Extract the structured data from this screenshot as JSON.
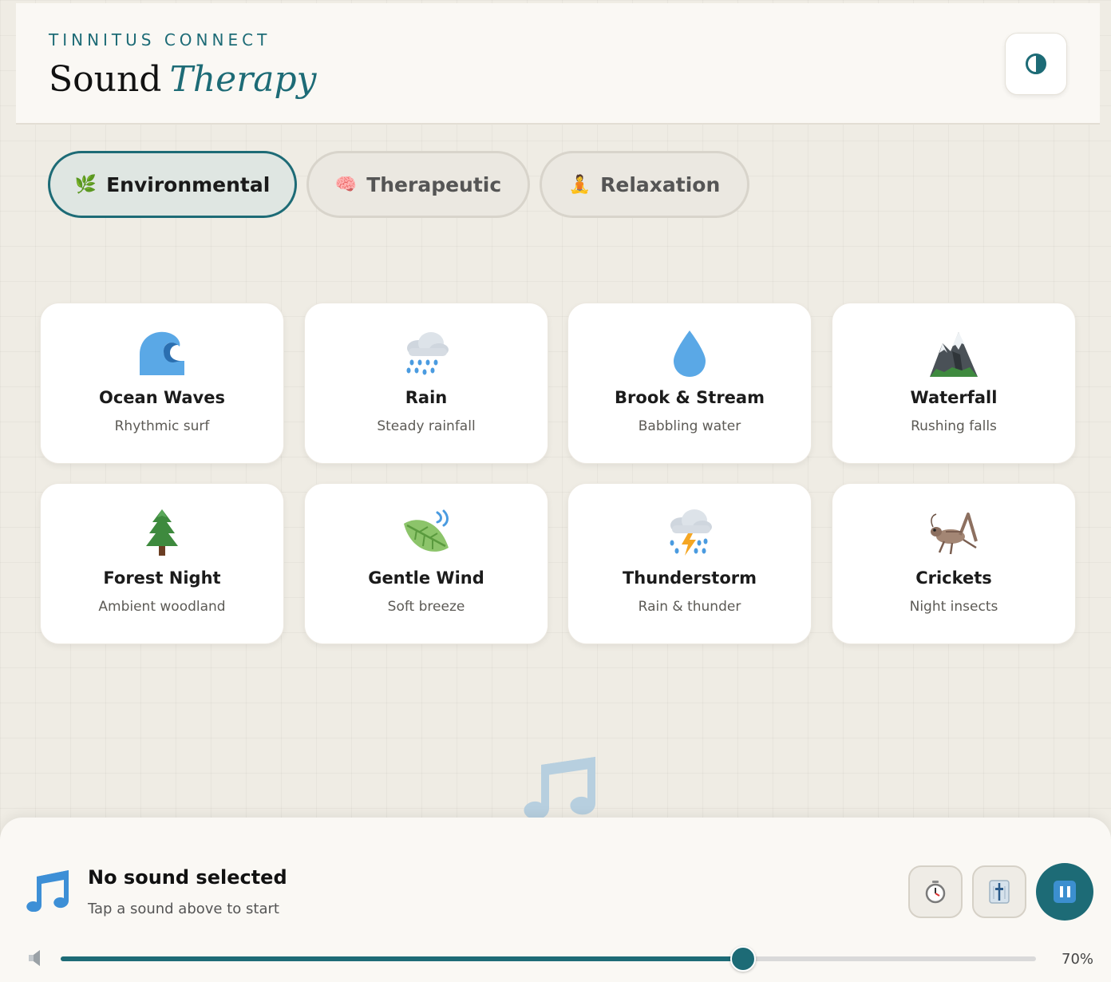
{
  "header": {
    "eyebrow": "TINNITUS CONNECT",
    "title_main": "Sound",
    "title_accent": "Therapy",
    "theme_toggle_icon": "contrast-icon"
  },
  "tabs": [
    {
      "label": "Environmental",
      "emoji": "🌿",
      "active": true
    },
    {
      "label": "Therapeutic",
      "emoji": "🧠",
      "active": false
    },
    {
      "label": "Relaxation",
      "emoji": "🧘",
      "active": false
    }
  ],
  "sounds": [
    {
      "name": "Ocean Waves",
      "desc": "Rhythmic surf",
      "icon": "wave-icon"
    },
    {
      "name": "Rain",
      "desc": "Steady rainfall",
      "icon": "rain-cloud-icon"
    },
    {
      "name": "Brook & Stream",
      "desc": "Babbling water",
      "icon": "droplet-icon"
    },
    {
      "name": "Waterfall",
      "desc": "Rushing falls",
      "icon": "mountain-icon"
    },
    {
      "name": "Forest Night",
      "desc": "Ambient woodland",
      "icon": "pine-tree-icon"
    },
    {
      "name": "Gentle Wind",
      "desc": "Soft breeze",
      "icon": "leaf-wind-icon"
    },
    {
      "name": "Thunderstorm",
      "desc": "Rain & thunder",
      "icon": "storm-cloud-icon"
    },
    {
      "name": "Crickets",
      "desc": "Night insects",
      "icon": "cricket-icon"
    }
  ],
  "player": {
    "title": "No sound selected",
    "subtitle": "Tap a sound above to start",
    "volume": 70,
    "volume_label": "70%",
    "controls": [
      "timer-icon",
      "mixer-icon",
      "pause-icon"
    ]
  },
  "colors": {
    "accent": "#1d6b76",
    "background": "#efece4",
    "card": "#ffffff"
  }
}
